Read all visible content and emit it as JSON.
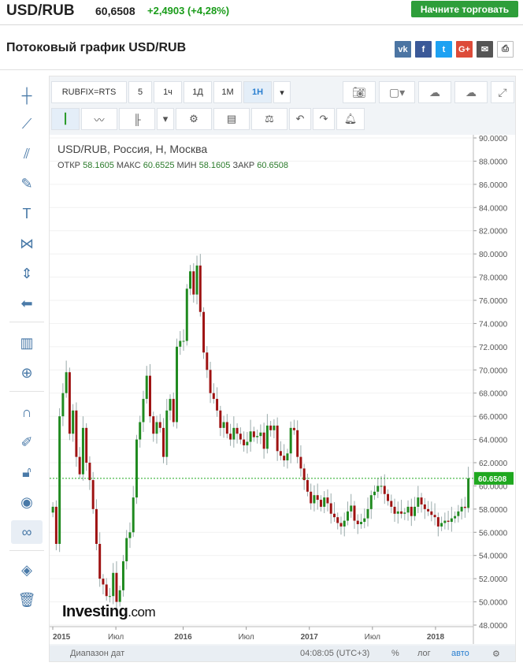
{
  "header": {
    "pair": "USD/RUB",
    "price": "60,6508",
    "change": "+2,4903 (+4,28%)",
    "trade_button": "Начните торговать"
  },
  "section": {
    "title": "Потоковый график USD/RUB"
  },
  "share_icons": [
    "vk-icon",
    "facebook-icon",
    "twitter-icon",
    "google-plus-icon",
    "email-icon",
    "print-icon"
  ],
  "left_tools": [
    "crosshair-icon",
    "trendline-icon",
    "pitchfork-icon",
    "brush-icon",
    "text-icon",
    "pattern-icon",
    "measure-icon",
    "back-arrow-icon",
    "indicators-icon",
    "zoom-in-icon",
    "magnet-icon",
    "lock-draw-icon",
    "unlock-icon",
    "eye-icon",
    "link-icon",
    "layers-icon",
    "trash-icon"
  ],
  "toolbar": {
    "symbol": "RUBFIX=RTS",
    "intervals": [
      "5",
      "1ч",
      "1Д",
      "1М",
      "1Н"
    ],
    "selected_interval": "1Н"
  },
  "legend": {
    "title": "USD/RUB, Россия, Н, Москва",
    "open_label": "ОТКР",
    "open": "58.1605",
    "high_label": "МАКС",
    "high": "60.6525",
    "low_label": "МИН",
    "low": "58.1605",
    "close_label": "ЗАКР",
    "close": "60.6508"
  },
  "logo": {
    "text": "Investing",
    "suffix": ".com"
  },
  "bottom": {
    "date_range": "Диапазон дат",
    "time": "04:08:05 (UTC+3)",
    "percent": "%",
    "log": "лог",
    "auto": "авто"
  },
  "colors": {
    "up": "#1f8a1f",
    "down": "#9e1212",
    "last_price": "#1fa81f",
    "tick_text": "#555555"
  },
  "chart_data": {
    "type": "candlestick",
    "title": "USD/RUB, Россия, Н, Москва",
    "ylim": [
      48,
      90
    ],
    "y_ticks": [
      "90.0000",
      "88.0000",
      "86.0000",
      "84.0000",
      "82.0000",
      "80.0000",
      "78.0000",
      "76.0000",
      "74.0000",
      "72.0000",
      "70.0000",
      "68.0000",
      "66.0000",
      "64.0000",
      "62.0000",
      "60.0000",
      "58.0000",
      "56.0000",
      "54.0000",
      "52.0000",
      "50.0000",
      "48.0000"
    ],
    "x_ticks": [
      "2015",
      "Июл",
      "2016",
      "Июл",
      "2017",
      "Июл",
      "2018"
    ],
    "last_price": "60.6508",
    "last_price_value": 60.6508,
    "series_close": [
      [
        58.2,
        55.0,
        66.0,
        68.0,
        69.8,
        64.5,
        66.5,
        62.5,
        61.0,
        65.0,
        62.0,
        60.5,
        58.0,
        55.0,
        52.0,
        51.5,
        50.5,
        50.5,
        52.5,
        50.0,
        51.0,
        53.5,
        55.5,
        56.0,
        59.0,
        64.0,
        65.5,
        67.5,
        69.5,
        66.0,
        64.5,
        65.5,
        65.0,
        62.5,
        66.5,
        67.5,
        65.5,
        72.0,
        72.5,
        72.5,
        77.0,
        78.5,
        76.5,
        79.0,
        75.0,
        71.5,
        70.0,
        68.0,
        67.5,
        66.5,
        65.0,
        65.5,
        64.5,
        64.0,
        65.0,
        64.5,
        64.0,
        63.5,
        63.8,
        64.7,
        64.2,
        64.3,
        64.6,
        63.2,
        65.2,
        64.8,
        65.2,
        63.0,
        62.6,
        62.2,
        62.8,
        65.0,
        64.8,
        62.5,
        61.5,
        60.5,
        59.5,
        58.5,
        59.2,
        58.8,
        58.2,
        59.0,
        58.5,
        57.6,
        57.3,
        56.8,
        56.5,
        57.0,
        57.8,
        58.3,
        57.0,
        56.7,
        56.9,
        57.2,
        58.0,
        59.2,
        59.5,
        60.0,
        60.0,
        59.3,
        58.7,
        58.2,
        57.6,
        57.8,
        57.6,
        57.7,
        58.2,
        57.4,
        58.2,
        59.0,
        58.4,
        58.0,
        57.8,
        57.5,
        57.3,
        56.5,
        56.8,
        57.0,
        56.9,
        57.2,
        57.4,
        57.8,
        58.2,
        58.1,
        60.65
      ]
    ],
    "x_start": "2015",
    "x_end": "2018"
  }
}
